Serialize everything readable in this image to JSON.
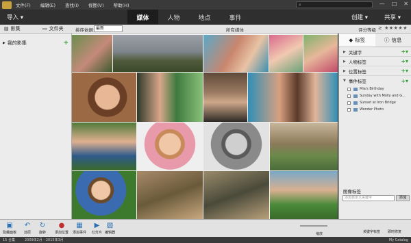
{
  "menubar": {
    "items": [
      "文件(F)",
      "编辑(E)",
      "查找(I)",
      "视图(V)",
      "帮助(H)"
    ],
    "window_controls": [
      "—",
      "□",
      "✕"
    ]
  },
  "toolbar": {
    "import_label": "导入 ▾",
    "tabs": [
      "媒体",
      "人物",
      "地点",
      "事件"
    ],
    "active_tab": "媒体",
    "create_label": "创建 ▾",
    "share_label": "共享 ▾"
  },
  "subbar": {
    "albums_tab": "影集",
    "folders_tab": "文件夹",
    "sort_label": "排序依据:",
    "sort_value": "最新",
    "media_label": "所有媒体",
    "rating_label": "评分等级",
    "stars": "≥ ★★★★★"
  },
  "left_panel": {
    "my_albums": "我的影集",
    "add": "+"
  },
  "right_panel": {
    "tabs": [
      "标签",
      "信息"
    ],
    "sections": [
      {
        "label": "关键字"
      },
      {
        "label": "人物标签"
      },
      {
        "label": "位置标签"
      },
      {
        "label": "事件标签"
      }
    ],
    "events": [
      "Mia's Birthday",
      "Sunday with Molly and G...",
      "Sunset at Iron Bridge",
      "Wonder Photo"
    ],
    "image_tags_label": "图像标签",
    "tag_input_placeholder": "添加自定义关键字",
    "add_button": "添加"
  },
  "bottombar": {
    "buttons": [
      {
        "label": "隐藏面板",
        "icon": "panel-icon"
      },
      {
        "label": "还原",
        "icon": "undo-icon"
      },
      {
        "label": "旋转",
        "icon": "rotate-icon"
      },
      {
        "label": "添加位置",
        "icon": "location-icon"
      },
      {
        "label": "添加事件",
        "icon": "event-icon"
      },
      {
        "label": "幻灯片",
        "icon": "slideshow-icon"
      },
      {
        "label": "编辑器",
        "icon": "editor-icon"
      }
    ],
    "zoom_label": "缩放",
    "keyword_tags": "关键字标签",
    "instant_fix": "即时修复"
  },
  "statusbar": {
    "count": "15 合集",
    "dates": "2009年2月 - 2015年3月",
    "catalog": "My Catalog"
  }
}
